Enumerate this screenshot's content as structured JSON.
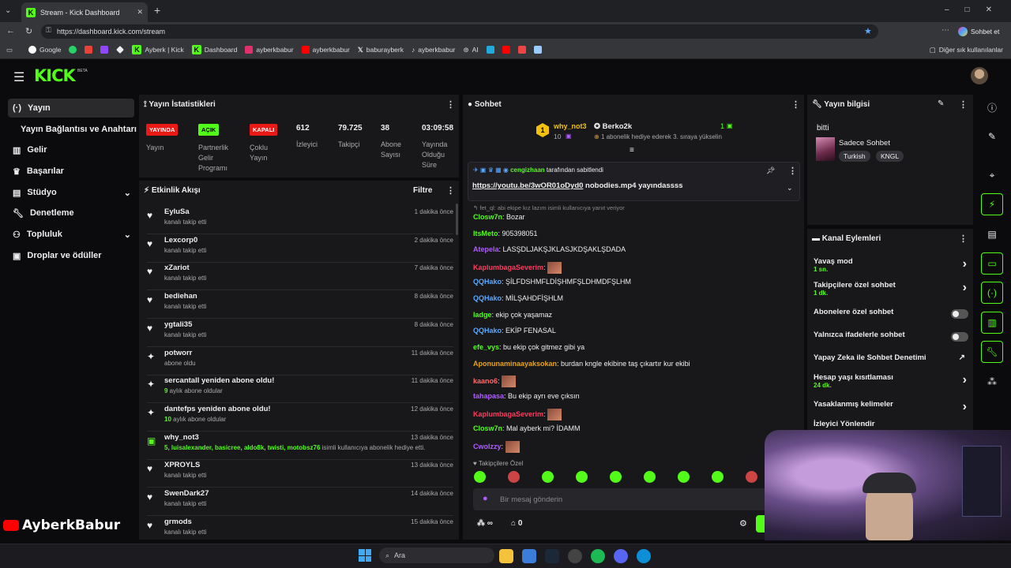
{
  "browser": {
    "tab_title": "Stream - Kick Dashboard",
    "url": "https://dashboard.kick.com/stream",
    "copilot_label": "Sohbet et",
    "bookmarks": [
      "Google",
      "",
      "",
      "",
      "",
      "Ayberk | Kick",
      "Dashboard",
      "ayberkbabur",
      "ayberkbabur",
      "baburayberk",
      "ayberkbabur",
      "AI"
    ],
    "other_bookmarks": "Diğer sık kullanılanlar"
  },
  "app": {
    "logo": "KICK",
    "logo_badge": "BETA"
  },
  "sidebar": {
    "items": [
      {
        "label": "Yayın",
        "icon": "broadcast-icon"
      },
      {
        "label": "Yayın Bağlantısı ve Anahtarı",
        "icon": ""
      },
      {
        "label": "Gelir",
        "icon": "chart-icon"
      },
      {
        "label": "Başarılar",
        "icon": "trophy-icon"
      },
      {
        "label": "Stüdyo",
        "icon": "studio-icon"
      },
      {
        "label": "Denetleme",
        "icon": "wrench-icon"
      },
      {
        "label": "Topluluk",
        "icon": "community-icon"
      },
      {
        "label": "Droplar ve ödüller",
        "icon": "gift-icon"
      }
    ]
  },
  "stats": {
    "title": "Yayın İstatistikleri",
    "yayin_badge": "YAYINDA",
    "yayin_label": "Yayın",
    "partner_badge": "AÇIK",
    "partner_label": "Partnerlik Gelir Programı",
    "multi_badge": "KAPALI",
    "multi_label": "Çoklu Yayın",
    "viewers": "612",
    "viewers_label": "İzleyici",
    "followers": "79.725",
    "followers_label": "Takipçi",
    "subs": "38",
    "subs_label": "Abone Sayısı",
    "uptime": "03:09:58",
    "uptime_label": "Yayında Olduğu Süre"
  },
  "activity": {
    "title": "Etkinlik Akışı",
    "filter": "Filtre",
    "events": [
      {
        "name": "EyluSa",
        "sub": "kanalı takip etti",
        "time": "1 dakika önce",
        "icon": "heart-icon"
      },
      {
        "name": "Lexcorp0",
        "sub": "kanalı takip etti",
        "time": "2 dakika önce",
        "icon": "heart-icon"
      },
      {
        "name": "xZariot",
        "sub": "kanalı takip etti",
        "time": "7 dakika önce",
        "icon": "heart-icon"
      },
      {
        "name": "bediehan",
        "sub": "kanalı takip etti",
        "time": "8 dakika önce",
        "icon": "heart-icon"
      },
      {
        "name": "ygtali35",
        "sub": "kanalı takip etti",
        "time": "8 dakika önce",
        "icon": "heart-icon"
      },
      {
        "name": "potworr",
        "sub": "abone oldu",
        "time": "11 dakika önce",
        "icon": "star-icon"
      },
      {
        "name": "sercantall yeniden abone oldu!",
        "sub_highlight": "9",
        "sub": " aylık abone oldular",
        "time": "11 dakika önce",
        "icon": "star-icon"
      },
      {
        "name": "dantefps yeniden abone oldu!",
        "sub_highlight": "10",
        "sub": " aylık abone oldular",
        "time": "12 dakika önce",
        "icon": "star-icon"
      },
      {
        "name": "why_not3",
        "sub_highlight": "5, luisalexander, basicree, aldo8k, twisti, motobsz76",
        "sub": " isimli kullanıcıya abonelik hediye etti.",
        "time": "13 dakika önce",
        "icon": "gift-icon"
      },
      {
        "name": "XPROYLS",
        "sub": "kanalı takip etti",
        "time": "13 dakika önce",
        "icon": "heart-icon"
      },
      {
        "name": "SwenDark27",
        "sub": "kanalı takip etti",
        "time": "14 dakika önce",
        "icon": "heart-icon"
      },
      {
        "name": "grmods",
        "sub": "kanalı takip etti",
        "time": "15 dakika önce",
        "icon": "heart-icon"
      }
    ]
  },
  "chat": {
    "title": "Sohbet",
    "top_gifter": "why_not3",
    "top_gifter_count": "10",
    "gift_user": "Berko2k",
    "gift_count": "1",
    "gift_text": "1 abonelik hediye ederek 3. sıraya yükselin",
    "pinned_by": "cengizhaan",
    "pinned_suffix": "tarafından sabitlendi",
    "pinned_link": "https://youtu.be/3wOR01oDyd0",
    "pinned_rest": " nobodies.mp4 yayındassss",
    "reply_hint": "fet_ql: abi ekipe kız lazım isimli kullanıcıya yanıt veriyor",
    "messages": [
      {
        "user": "Closw7n",
        "color": "#53fc18",
        "text": "Bozar"
      },
      {
        "user": "ItsMeto",
        "color": "#53fc18",
        "text": "905398051"
      },
      {
        "user": "Atepela",
        "color": "#b05cff",
        "text": "LASŞDLJAKŞJKLASJKDŞAKLŞDADA"
      },
      {
        "user": "KaplumbagaSeverim",
        "color": "#ff3b5c",
        "text": "",
        "emote": true
      },
      {
        "user": "QQHako",
        "color": "#5aa9ff",
        "text": "ŞİLFDSHMFLDİŞHMFŞLDHMDFŞLHM"
      },
      {
        "user": "QQHako",
        "color": "#5aa9ff",
        "text": "MİLŞAHDFİŞHLM"
      },
      {
        "user": "ladge",
        "color": "#53fc18",
        "text": "ekip çok yaşamaz"
      },
      {
        "user": "QQHako",
        "color": "#5aa9ff",
        "text": "EKİP FENASAL"
      },
      {
        "user": "efe_vys",
        "color": "#53fc18",
        "text": "bu ekip çok gitmez gibi ya"
      },
      {
        "user": "Aponunaminaayaksokan",
        "color": "#e8a317",
        "text": "burdan kngle ekibine taş çıkartır kur ekibi"
      },
      {
        "user": "kaano6",
        "color": "#ff6b6b",
        "text": "",
        "emote": true
      },
      {
        "user": "tahapasa",
        "color": "#b05cff",
        "text": "Bu ekip ayrı eve çıksın"
      },
      {
        "user": "KaplumbagaSeverim",
        "color": "#ff3b5c",
        "text": "",
        "emote": true
      },
      {
        "user": "Closw7n",
        "color": "#53fc18",
        "text": "Mal ayberk mi? İDAMM"
      },
      {
        "user": "Cwolzzy",
        "color": "#b05cff",
        "text": "",
        "emote": true
      }
    ],
    "emote_section": "Takipçilere Özel",
    "input_placeholder": "Bir mesaj gönderin",
    "points": "∞",
    "bank": "0"
  },
  "stream_info": {
    "title": "Yayın bilgisi",
    "stream_title": "bitti",
    "category": "Sadece Sohbet",
    "tags": [
      "Turkish",
      "KNGL"
    ]
  },
  "channel_actions": {
    "title": "Kanal Eylemleri",
    "rows": [
      {
        "label": "Yavaş mod",
        "sub": "1 sn.",
        "control": "arrow"
      },
      {
        "label": "Takipçilere özel sohbet",
        "sub": "1 dk.",
        "control": "arrow"
      },
      {
        "label": "Abonelere özel sohbet",
        "sub": "",
        "control": "toggle"
      },
      {
        "label": "Yalnızca ifadelerle sohbet",
        "sub": "",
        "control": "toggle"
      },
      {
        "label": "Yapay Zeka ile Sohbet Denetimi",
        "sub": "",
        "control": "external"
      },
      {
        "label": "Hesap yaşı kısıtlaması",
        "sub": "24 dk.",
        "control": "arrow"
      },
      {
        "label": "Yasaklanmış kelimeler",
        "sub": "",
        "control": "arrow"
      },
      {
        "label": "İzleyici Yönlendir",
        "sub": "",
        "control": ""
      }
    ]
  },
  "watermark": "AyberkBabur",
  "taskbar": {
    "search": "Ara"
  },
  "colors": {
    "accent": "#53fc18",
    "live": "#e91916",
    "panel": "#18181b",
    "bg": "#0b0b0d"
  }
}
